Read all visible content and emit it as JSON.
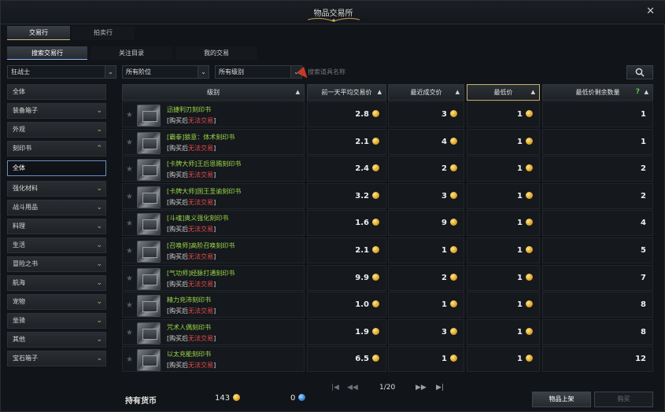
{
  "window": {
    "title": "物品交易所",
    "close_symbol": "✕"
  },
  "top_tabs": [
    {
      "label": "交易行",
      "active": true
    },
    {
      "label": "拍卖行",
      "active": false
    }
  ],
  "sub_tabs": [
    {
      "label": "搜索交易行",
      "active": true
    },
    {
      "label": "关注目录",
      "active": false
    },
    {
      "label": "我的交易",
      "active": false
    }
  ],
  "filters": {
    "class_select": "狂战士",
    "tier_select": "所有阶位",
    "grade_select": "所有级别",
    "search_placeholder": "搜索道具名称",
    "chevron": "⌄"
  },
  "categories": [
    {
      "label": "全体",
      "chev": ""
    },
    {
      "label": "装备箱子",
      "chev": "⌄"
    },
    {
      "label": "外观",
      "chev": "⌄"
    },
    {
      "label": "刻印书",
      "chev": "⌃"
    },
    {
      "label": "全体",
      "chev": ""
    },
    {
      "label": "强化材料",
      "chev": "⌄"
    },
    {
      "label": "战斗用品",
      "chev": "⌄"
    },
    {
      "label": "料理",
      "chev": "⌄"
    },
    {
      "label": "生活",
      "chev": "⌄"
    },
    {
      "label": "冒险之书",
      "chev": "⌄"
    },
    {
      "label": "航海",
      "chev": "⌄"
    },
    {
      "label": "宠物",
      "chev": "⌄"
    },
    {
      "label": "坐骑",
      "chev": "⌄"
    },
    {
      "label": "其他",
      "chev": "⌄"
    },
    {
      "label": "宝石箱子",
      "chev": "⌄"
    }
  ],
  "columns": {
    "grade": "级别",
    "avg_price": "前一天平均交易价",
    "recent_price": "最近成交价",
    "lowest_price": "最低价",
    "remaining": "最低价剩余数量",
    "sort_arrow": "▲",
    "help": "?"
  },
  "items": [
    {
      "name": "迅捷利刃刻印书",
      "note_pre": "[购买后",
      "note_warn": "无法交易",
      "note_post": "]",
      "avg": "2.8",
      "recent": "3",
      "lowest": "1",
      "remaining": "1"
    },
    {
      "name": "[霸拳]狼意：体术刻印书",
      "note_pre": "[购买后",
      "note_warn": "无法交易",
      "note_post": "]",
      "avg": "2.1",
      "recent": "4",
      "lowest": "1",
      "remaining": "1"
    },
    {
      "name": "[卡牌大师]王后恩赐刻印书",
      "note_pre": "[购买后",
      "note_warn": "无法交易",
      "note_post": "]",
      "avg": "2.4",
      "recent": "2",
      "lowest": "1",
      "remaining": "2"
    },
    {
      "name": "[卡牌大师]国王圣谕刻印书",
      "note_pre": "[购买后",
      "note_warn": "无法交易",
      "note_post": "]",
      "avg": "3.2",
      "recent": "3",
      "lowest": "1",
      "remaining": "2"
    },
    {
      "name": "[斗魂]奥义强化刻印书",
      "note_pre": "[购买后",
      "note_warn": "无法交易",
      "note_post": "]",
      "avg": "1.6",
      "recent": "9",
      "lowest": "1",
      "remaining": "4"
    },
    {
      "name": "[召唤师]高阶召唤刻印书",
      "note_pre": "[购买后",
      "note_warn": "无法交易",
      "note_post": "]",
      "avg": "2.1",
      "recent": "1",
      "lowest": "1",
      "remaining": "5"
    },
    {
      "name": "[气功师]经脉打通刻印书",
      "note_pre": "[购买后",
      "note_warn": "无法交易",
      "note_post": "]",
      "avg": "9.9",
      "recent": "2",
      "lowest": "1",
      "remaining": "7"
    },
    {
      "name": "精力充沛刻印书",
      "note_pre": "[购买后",
      "note_warn": "无法交易",
      "note_post": "]",
      "avg": "1.0",
      "recent": "1",
      "lowest": "1",
      "remaining": "8"
    },
    {
      "name": "咒术人偶刻印书",
      "note_pre": "[购买后",
      "note_warn": "无法交易",
      "note_post": "]",
      "avg": "1.9",
      "recent": "3",
      "lowest": "1",
      "remaining": "8"
    },
    {
      "name": "以太充能刻印书",
      "note_pre": "[购买后",
      "note_warn": "无法交易",
      "note_post": "]",
      "avg": "6.5",
      "recent": "1",
      "lowest": "1",
      "remaining": "12"
    }
  ],
  "footer": {
    "currency_label": "持有货币",
    "gold": "143",
    "blue": "0",
    "pager_first": "|◀",
    "pager_prev": "◀◀",
    "page": "1/20",
    "pager_next": "▶▶",
    "pager_last": "▶|",
    "list_button": "物品上架",
    "buy_button": "购买"
  },
  "colors": {
    "item_name": "#9bd84a",
    "warn": "#e34b4b",
    "accent_gold": "#c9b36a",
    "selected_border": "#6a8fc1"
  }
}
